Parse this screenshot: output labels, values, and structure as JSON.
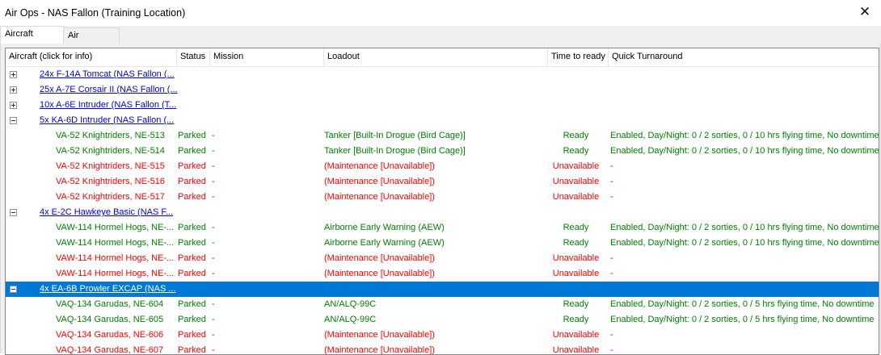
{
  "window": {
    "title": "Air Ops - NAS Fallon (Training Location)",
    "close_glyph": "✕"
  },
  "tabs": [
    {
      "label": "Aircraft Status"
    },
    {
      "label": "Air Facilities"
    }
  ],
  "columns": {
    "aircraft": "Aircraft (click for info)",
    "status": "Status",
    "mission": "Mission",
    "loadout": "Loadout",
    "time": "Time to ready",
    "turnaround": "Quick Turnaround"
  },
  "groups": [
    {
      "label": "24x F-14A Tomcat (NAS Fallon (...",
      "expanded": false,
      "selected": false,
      "rows": []
    },
    {
      "label": "25x A-7E Corsair II (NAS Fallon (...",
      "expanded": false,
      "selected": false,
      "rows": []
    },
    {
      "label": "10x A-6E Intruder (NAS Fallon (T...",
      "expanded": false,
      "selected": false,
      "rows": []
    },
    {
      "label": "5x KA-6D Intruder (NAS Fallon (...",
      "expanded": true,
      "selected": false,
      "rows": [
        {
          "name": "VA-52 Knightriders, NE-513",
          "status": "Parked",
          "mission": "-",
          "loadout": "Tanker [Built-In Drogue (Bird Cage)]",
          "time": "Ready",
          "turnaround": "Enabled, Day/Night: 0 / 2 sorties, 0 / 10 hrs flying time, No downtime",
          "state": "ok"
        },
        {
          "name": "VA-52 Knightriders, NE-514",
          "status": "Parked",
          "mission": "-",
          "loadout": "Tanker [Built-In Drogue (Bird Cage)]",
          "time": "Ready",
          "turnaround": "Enabled, Day/Night: 0 / 2 sorties, 0 / 10 hrs flying time, No downtime",
          "state": "ok"
        },
        {
          "name": "VA-52 Knightriders, NE-515",
          "status": "Parked",
          "mission": "-",
          "loadout": "(Maintenance [Unavailable])",
          "time": "Unavailable",
          "turnaround": "-",
          "state": "bad"
        },
        {
          "name": "VA-52 Knightriders, NE-516",
          "status": "Parked",
          "mission": "-",
          "loadout": "(Maintenance [Unavailable])",
          "time": "Unavailable",
          "turnaround": "-",
          "state": "bad"
        },
        {
          "name": "VA-52 Knightriders, NE-517",
          "status": "Parked",
          "mission": "-",
          "loadout": "(Maintenance [Unavailable])",
          "time": "Unavailable",
          "turnaround": "-",
          "state": "bad"
        }
      ]
    },
    {
      "label": "4x E-2C Hawkeye Basic (NAS F...",
      "expanded": true,
      "selected": false,
      "rows": [
        {
          "name": "VAW-114 Hormel Hogs, NE-...",
          "status": "Parked",
          "mission": "-",
          "loadout": "Airborne Early Warning (AEW)",
          "time": "Ready",
          "turnaround": "Enabled, Day/Night: 0 / 2 sorties, 0 / 10 hrs flying time, No downtime",
          "state": "ok"
        },
        {
          "name": "VAW-114 Hormel Hogs, NE-...",
          "status": "Parked",
          "mission": "-",
          "loadout": "Airborne Early Warning (AEW)",
          "time": "Ready",
          "turnaround": "Enabled, Day/Night: 0 / 2 sorties, 0 / 10 hrs flying time, No downtime",
          "state": "ok"
        },
        {
          "name": "VAW-114 Hormel Hogs, NE-...",
          "status": "Parked",
          "mission": "-",
          "loadout": "(Maintenance [Unavailable])",
          "time": "Unavailable",
          "turnaround": "-",
          "state": "bad"
        },
        {
          "name": "VAW-114 Hormel Hogs, NE-...",
          "status": "Parked",
          "mission": "-",
          "loadout": "(Maintenance [Unavailable])",
          "time": "Unavailable",
          "turnaround": "-",
          "state": "bad"
        }
      ]
    },
    {
      "label": "4x EA-6B Prowler EXCAP (NAS ...",
      "expanded": true,
      "selected": true,
      "rows": [
        {
          "name": "VAQ-134 Garudas, NE-604",
          "status": "Parked",
          "mission": "-",
          "loadout": "AN/ALQ-99C",
          "time": "Ready",
          "turnaround": "Enabled, Day/Night: 0 / 2 sorties, 0 / 5 hrs flying time, No downtime",
          "state": "ok"
        },
        {
          "name": "VAQ-134 Garudas, NE-605",
          "status": "Parked",
          "mission": "-",
          "loadout": "AN/ALQ-99C",
          "time": "Ready",
          "turnaround": "Enabled, Day/Night: 0 / 2 sorties, 0 / 5 hrs flying time, No downtime",
          "state": "ok"
        },
        {
          "name": "VAQ-134 Garudas, NE-606",
          "status": "Parked",
          "mission": "-",
          "loadout": "(Maintenance [Unavailable])",
          "time": "Unavailable",
          "turnaround": "-",
          "state": "bad"
        },
        {
          "name": "VAQ-134 Garudas, NE-607",
          "status": "Parked",
          "mission": "-",
          "loadout": "(Maintenance [Unavailable])",
          "time": "Unavailable",
          "turnaround": "-",
          "state": "bad"
        }
      ]
    }
  ],
  "colors": {
    "ready": "#008000",
    "unavailable": "#ff0000",
    "link": "#0000ee",
    "selection": "#0078d7"
  }
}
